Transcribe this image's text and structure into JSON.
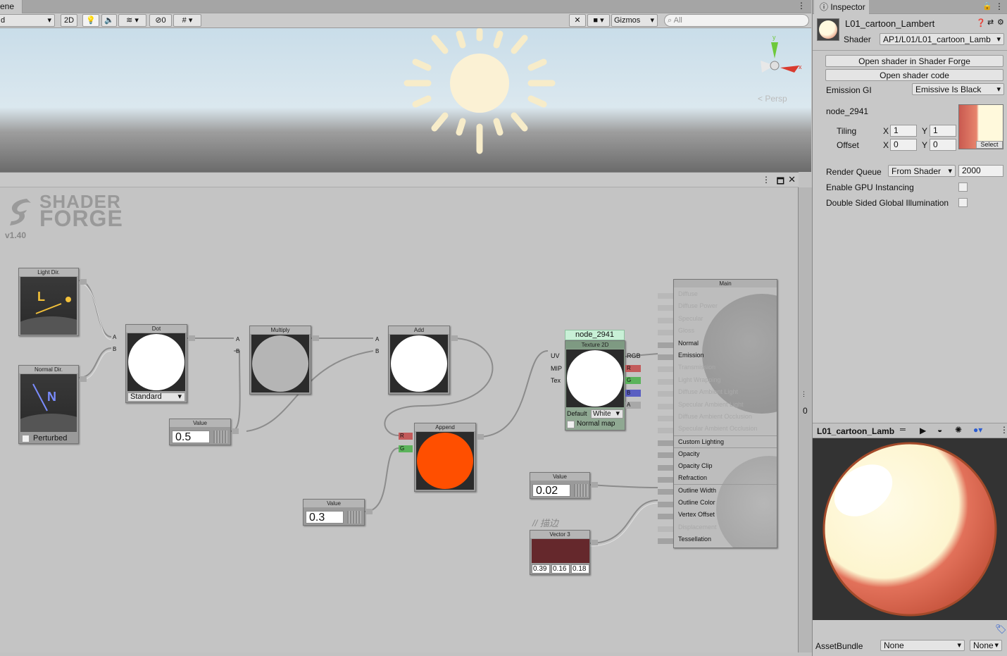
{
  "scene": {
    "tab_label": "ene",
    "draw_mode": "d",
    "btn_2d": "2D",
    "hidden_count": "0",
    "gizmos_label": "Gizmos",
    "search_placeholder": "All",
    "persp_label": "< Persp",
    "gizmo_axes": {
      "x": "x",
      "y": "y"
    }
  },
  "shader_forge": {
    "logo_line1": "SHADER",
    "logo_line2": "FORGE",
    "version": "v1.40",
    "side_value": "0",
    "nodes": {
      "light_dir": {
        "title": "Light Dir.",
        "glyph": "L"
      },
      "normal_dir": {
        "title": "Normal Dir.",
        "glyph": "N",
        "perturbed_label": "Perturbed"
      },
      "dot": {
        "title": "Dot",
        "port_a": "A",
        "port_b": "B",
        "mode": "Standard"
      },
      "multiply": {
        "title": "Multiply",
        "port_a": "A",
        "port_b": "B"
      },
      "add": {
        "title": "Add",
        "port_a": "A",
        "port_b": "B"
      },
      "value_05": {
        "title": "Value",
        "value": "0.5"
      },
      "append": {
        "title": "Append",
        "port_r": "R",
        "port_g": "G",
        "color": "#ff4f00"
      },
      "value_03": {
        "title": "Value",
        "value": "0.3"
      },
      "value_002": {
        "title": "Value",
        "value": "0.02"
      },
      "texture": {
        "name": "node_2941",
        "title": "Texture 2D",
        "in_uv": "UV",
        "in_mip": "MIP",
        "in_tex": "Tex",
        "out_rgb": "RGB",
        "out_r": "R",
        "out_g": "G",
        "out_b": "B",
        "out_a": "A",
        "default_label": "Default",
        "default_value": "White",
        "normal_map_label": "Normal map"
      },
      "comment": "// 描边",
      "vector3": {
        "title": "Vector 3",
        "x": "0.39",
        "y": "0.16",
        "z": "0.18",
        "color": "#65282c"
      }
    },
    "main": {
      "title": "Main",
      "inputs": [
        {
          "label": "Diffuse",
          "active": false
        },
        {
          "label": "Diffuse Power",
          "active": false
        },
        {
          "label": "Specular",
          "active": false
        },
        {
          "label": "Gloss",
          "active": false
        },
        {
          "label": "Normal",
          "active": true
        },
        {
          "label": "Emission",
          "active": true
        },
        {
          "label": "Transmission",
          "active": false
        },
        {
          "label": "Light Wrapping",
          "active": false
        },
        {
          "label": "Diffuse Ambient Light",
          "active": false
        },
        {
          "label": "Specular Ambient Light",
          "active": false
        },
        {
          "label": "Diffuse Ambient Occlusion",
          "active": false
        },
        {
          "label": "Specular Ambient Occlusion",
          "active": false
        },
        {
          "label": "Custom Lighting",
          "active": true
        },
        {
          "label": "Opacity",
          "active": true
        },
        {
          "label": "Opacity Clip",
          "active": true
        },
        {
          "label": "Refraction",
          "active": true
        },
        {
          "label": "Outline Width",
          "active": true
        },
        {
          "label": "Outline Color",
          "active": true
        },
        {
          "label": "Vertex Offset",
          "active": true
        },
        {
          "label": "Displacement",
          "active": false
        },
        {
          "label": "Tessellation",
          "active": true
        }
      ]
    }
  },
  "inspector": {
    "tab_label": "Inspector",
    "material_name": "L01_cartoon_Lambert",
    "shader_label": "Shader",
    "shader_value": "AP1/L01/L01_cartoon_Lamb",
    "open_sf_button": "Open shader in Shader Forge",
    "open_code_button": "Open shader code",
    "emission_gi_label": "Emission GI",
    "emission_gi_value": "Emissive Is Black",
    "texture_prop": "node_2941",
    "tiling_label": "Tiling",
    "offset_label": "Offset",
    "x_label": "X",
    "y_label": "Y",
    "tiling_x": "1",
    "tiling_y": "1",
    "offset_x": "0",
    "offset_y": "0",
    "select_label": "Select",
    "render_queue_label": "Render Queue",
    "render_queue_mode": "From Shader",
    "render_queue_value": "2000",
    "gpu_instancing_label": "Enable GPU Instancing",
    "double_sided_gi_label": "Double Sided Global Illumination",
    "preview_title": "L01_cartoon_Lamb",
    "assetbundle_label": "AssetBundle",
    "assetbundle_value": "None",
    "assetbundle_variant": "None"
  }
}
